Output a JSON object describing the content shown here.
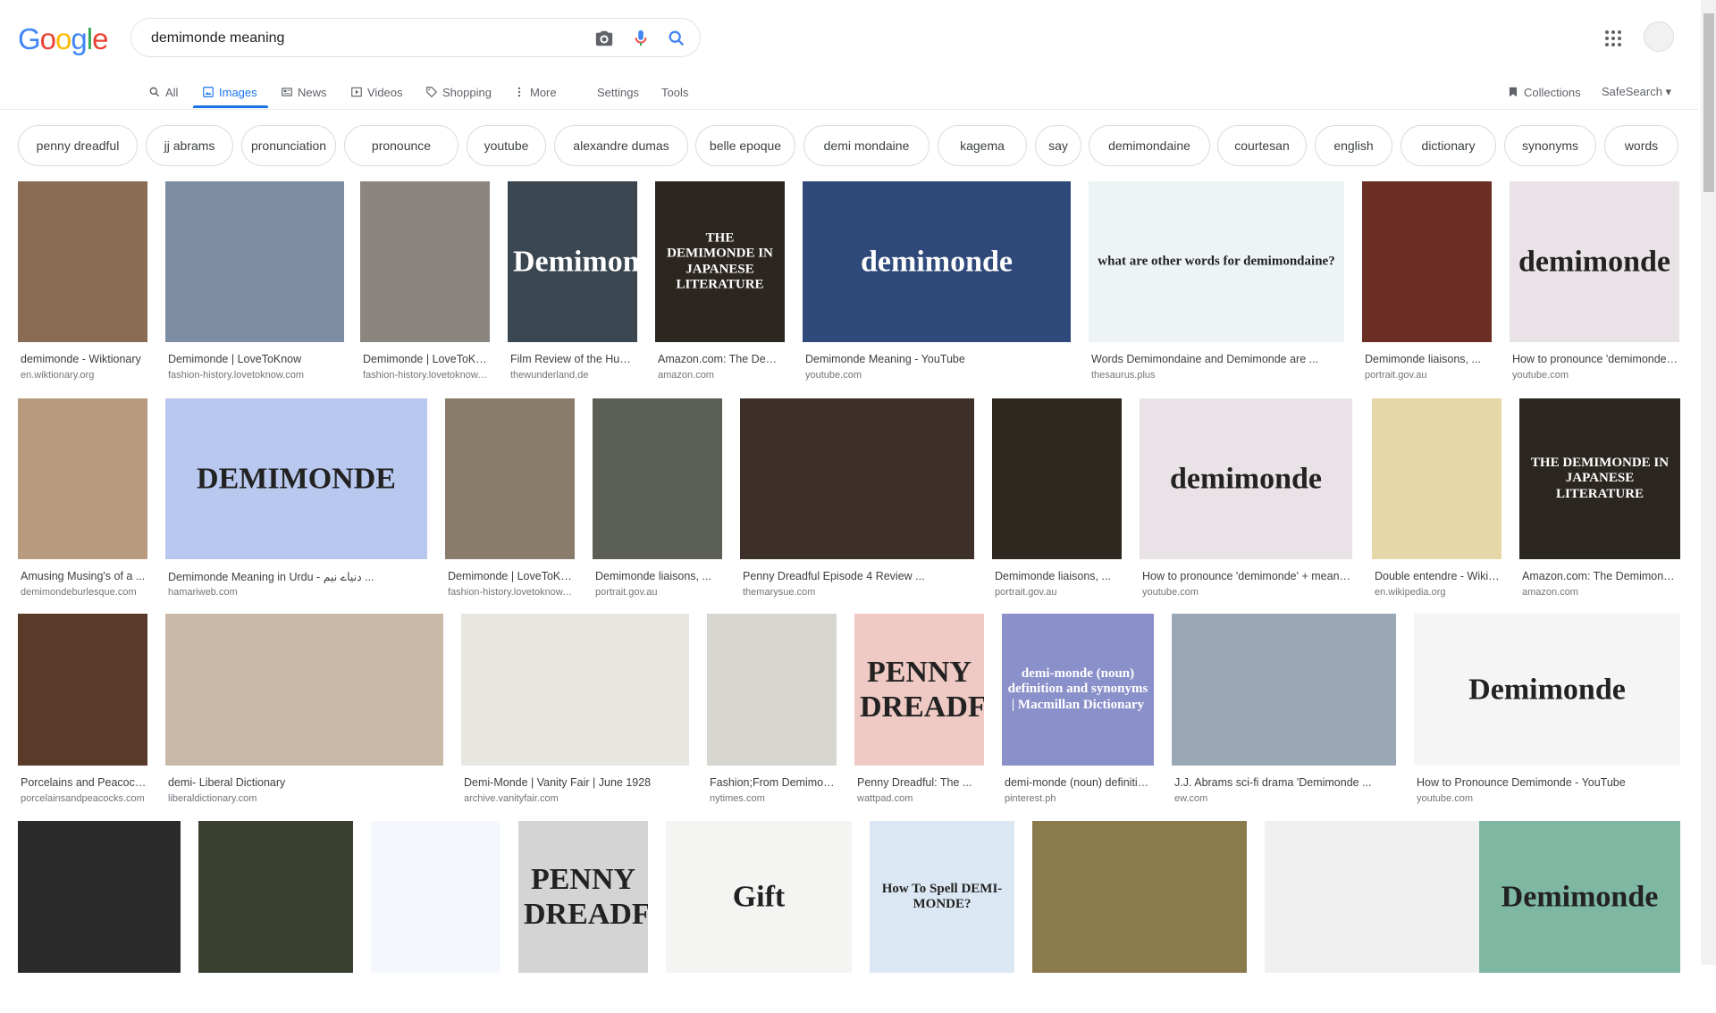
{
  "logo": {
    "letters": [
      "G",
      "o",
      "o",
      "g",
      "l",
      "e"
    ],
    "colors": [
      "#4285F4",
      "#EA4335",
      "#FBBC05",
      "#4285F4",
      "#34A853",
      "#EA4335"
    ]
  },
  "search": {
    "value": "demimonde meaning",
    "placeholder": ""
  },
  "tabs": [
    {
      "label": "All",
      "icon": "search-icon"
    },
    {
      "label": "Images",
      "icon": "image-icon",
      "active": true
    },
    {
      "label": "News",
      "icon": "news-icon"
    },
    {
      "label": "Videos",
      "icon": "video-icon"
    },
    {
      "label": "Shopping",
      "icon": "tag-icon"
    },
    {
      "label": "More",
      "icon": "more-vert-icon"
    },
    {
      "label": "Settings"
    },
    {
      "label": "Tools"
    }
  ],
  "right_tools": {
    "collections": "Collections",
    "safesearch": "SafeSearch ▾"
  },
  "chips": [
    "penny dreadful",
    "jj abrams",
    "pronunciation",
    "pronounce",
    "youtube",
    "alexandre dumas",
    "belle epoque",
    "demi mondaine",
    "kagema",
    "say",
    "demimondaine",
    "courtesan",
    "english",
    "dictionary",
    "synonyms",
    "words"
  ],
  "results": [
    {
      "title": "demimonde - Wiktionary",
      "source": "en.wiktionary.org",
      "thumb_text": "",
      "bg": "#8a6c55"
    },
    {
      "title": "Demimonde | LoveToKnow",
      "source": "fashion-history.lovetoknow.com",
      "thumb_text": "",
      "bg": "#7d8da3"
    },
    {
      "title": "Demimonde | LoveToKnow",
      "source": "fashion-history.lovetoknow.com",
      "thumb_text": "",
      "bg": "#8b8580"
    },
    {
      "title": "Film Review of the Hungarian ...",
      "source": "thewunderland.de",
      "thumb_text": "Demimonde",
      "bg": "#3a4650"
    },
    {
      "title": "Amazon.com: The Demimonde ...",
      "source": "amazon.com",
      "thumb_text": "THE DEMIMONDE IN JAPANESE LITERATURE",
      "bg": "#2c2620"
    },
    {
      "title": "Demimonde Meaning - YouTube",
      "source": "youtube.com",
      "thumb_text": "demimonde",
      "bg": "#2f4a7a"
    },
    {
      "title": "Words Demimondaine and Demimonde are ...",
      "source": "thesaurus.plus",
      "thumb_text": "what are other words for demimondaine?",
      "bg": "#eef4f6"
    },
    {
      "title": "Demimonde liaisons, ...",
      "source": "portrait.gov.au",
      "thumb_text": "",
      "bg": "#6b2e24"
    },
    {
      "title": "How to pronounce 'demimonde' ...",
      "source": "youtube.com",
      "thumb_text": "demimonde",
      "bg": "#e9e2e6"
    },
    {
      "title": "Amusing Musing's of a ...",
      "source": "demimondeburlesque.com",
      "thumb_text": "",
      "bg": "#b89a7e"
    },
    {
      "title": "Demimonde Meaning in Urdu - دنیاے نیم ...",
      "source": "hamariweb.com",
      "thumb_text": "DEMIMONDE",
      "bg": "#b9c8ee"
    },
    {
      "title": "Demimonde | LoveToKnow",
      "source": "fashion-history.lovetoknow.com",
      "thumb_text": "",
      "bg": "#8a7c6a"
    },
    {
      "title": "Demimonde liaisons, ...",
      "source": "portrait.gov.au",
      "thumb_text": "",
      "bg": "#5c5f55"
    },
    {
      "title": "Penny Dreadful Episode 4 Review ...",
      "source": "themarysue.com",
      "thumb_text": "",
      "bg": "#3d3028"
    },
    {
      "title": "Demimonde liaisons, ...",
      "source": "portrait.gov.au",
      "thumb_text": "",
      "bg": "#2e2820"
    },
    {
      "title": "How to pronounce 'demimonde' + meaning ...",
      "source": "youtube.com",
      "thumb_text": "demimonde",
      "bg": "#e9e2e6"
    },
    {
      "title": "Double entendre - Wikipedia",
      "source": "en.wikipedia.org",
      "thumb_text": "",
      "bg": "#e6d7a8"
    },
    {
      "title": "Amazon.com: The Demimonde ...",
      "source": "amazon.com",
      "thumb_text": "THE DEMIMONDE IN JAPANESE LITERATURE",
      "bg": "#2c2620"
    },
    {
      "title": "Porcelains and Peacocks ...",
      "source": "porcelainsandpeacocks.com",
      "thumb_text": "",
      "bg": "#5a3a28"
    },
    {
      "title": "demi- Liberal Dictionary",
      "source": "liberaldictionary.com",
      "thumb_text": "",
      "bg": "#c9b9a8"
    },
    {
      "title": "Demi-Monde | Vanity Fair | June 1928",
      "source": "archive.vanityfair.com",
      "thumb_text": "",
      "bg": "#e8e6e0"
    },
    {
      "title": "Fashion;From Demimonde ...",
      "source": "nytimes.com",
      "thumb_text": "",
      "bg": "#d8d6d0"
    },
    {
      "title": "Penny Dreadful: The ...",
      "source": "wattpad.com",
      "thumb_text": "PENNY DREADFUL",
      "bg": "#efc9c4"
    },
    {
      "title": "demi-monde (noun) definition ...",
      "source": "pinterest.ph",
      "thumb_text": "demi-monde (noun) definition and synonyms | Macmillan Dictionary",
      "bg": "#8a90c9"
    },
    {
      "title": "J.J. Abrams sci-fi drama 'Demimonde ...",
      "source": "ew.com",
      "thumb_text": "",
      "bg": "#9aa7b5"
    },
    {
      "title": "How to Pronounce Demimonde - YouTube",
      "source": "youtube.com",
      "thumb_text": "Demimonde",
      "bg": "#f5f5f5"
    },
    {
      "title": "",
      "source": "",
      "thumb_text": "",
      "bg": "#2a2a2a"
    },
    {
      "title": "",
      "source": "",
      "thumb_text": "",
      "bg": "#3a4030"
    },
    {
      "title": "",
      "source": "",
      "thumb_text": "",
      "bg": "#f4f8fc"
    },
    {
      "title": "",
      "source": "",
      "thumb_text": "PENNY DREADFUL",
      "bg": "#d4d4d4"
    },
    {
      "title": "",
      "source": "",
      "thumb_text": "Gift",
      "bg": "#f4f4f2"
    },
    {
      "title": "",
      "source": "",
      "thumb_text": "How To Spell DEMI-MONDE?",
      "bg": "#dbe8f4"
    },
    {
      "title": "",
      "source": "",
      "thumb_text": "",
      "bg": "#8a7a4c"
    },
    {
      "title": "",
      "source": "",
      "thumb_text": "",
      "bg": "#f0f0f0"
    },
    {
      "title": "",
      "source": "",
      "thumb_text": "Demimonde",
      "bg": "#7fb8a2"
    }
  ]
}
